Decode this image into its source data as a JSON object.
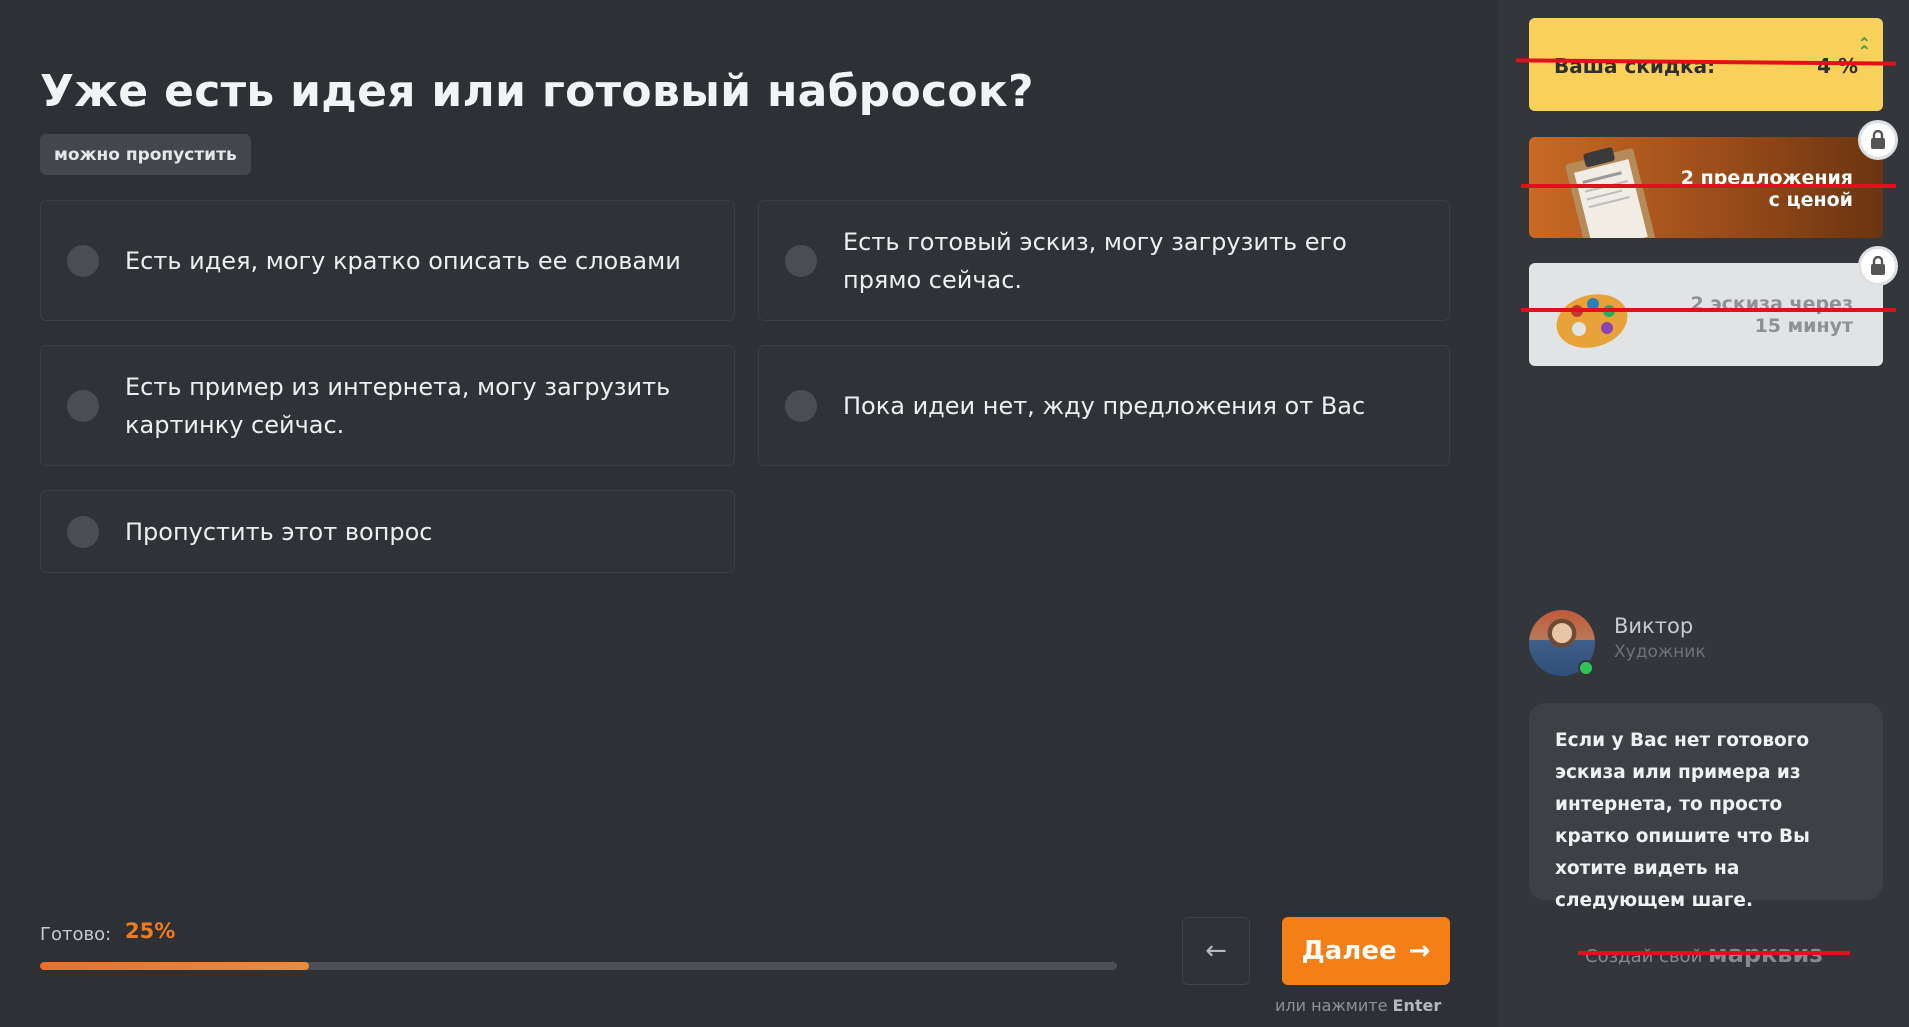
{
  "question": {
    "title": "Уже есть идея или готовый набросок?",
    "skip_badge": "можно пропустить"
  },
  "options": [
    {
      "label": "Есть идея, могу кратко описать ее словами"
    },
    {
      "label": "Есть готовый эскиз, могу загрузить его прямо сейчас."
    },
    {
      "label": "Есть пример из интернета, могу загрузить картинку сейчас."
    },
    {
      "label": "Пока идеи нет, жду предложения от Вас"
    },
    {
      "label": "Пропустить этот вопрос"
    }
  ],
  "progress": {
    "label": "Готово:",
    "value_text": "25%",
    "value": 0.25
  },
  "navigation": {
    "back_icon": "←",
    "next_label": "Далее",
    "next_icon": "→",
    "hint_prefix": "или нажмите",
    "hint_key": "Enter"
  },
  "sidebar": {
    "discount": {
      "label": "Ваша скидка:",
      "value": "4 %",
      "up_icon": "⌃"
    },
    "offers": [
      {
        "text": "2 предложения с ценой",
        "locked": true
      },
      {
        "text": "2 эскиза через 15 минут",
        "locked": true
      }
    ],
    "agent": {
      "name": "Виктор",
      "role": "Художник",
      "message": "Если у Вас нет готового эскиза или примера из интернета, то просто кратко опишите что Вы хотите видеть на следующем шаге."
    },
    "footer": {
      "prefix": "Создай свой",
      "brand": "марквиз"
    }
  },
  "colors": {
    "accent": "#f57f17",
    "background": "#2d3034",
    "discount_card": "#f9d15a",
    "strike": "#e0111d"
  }
}
